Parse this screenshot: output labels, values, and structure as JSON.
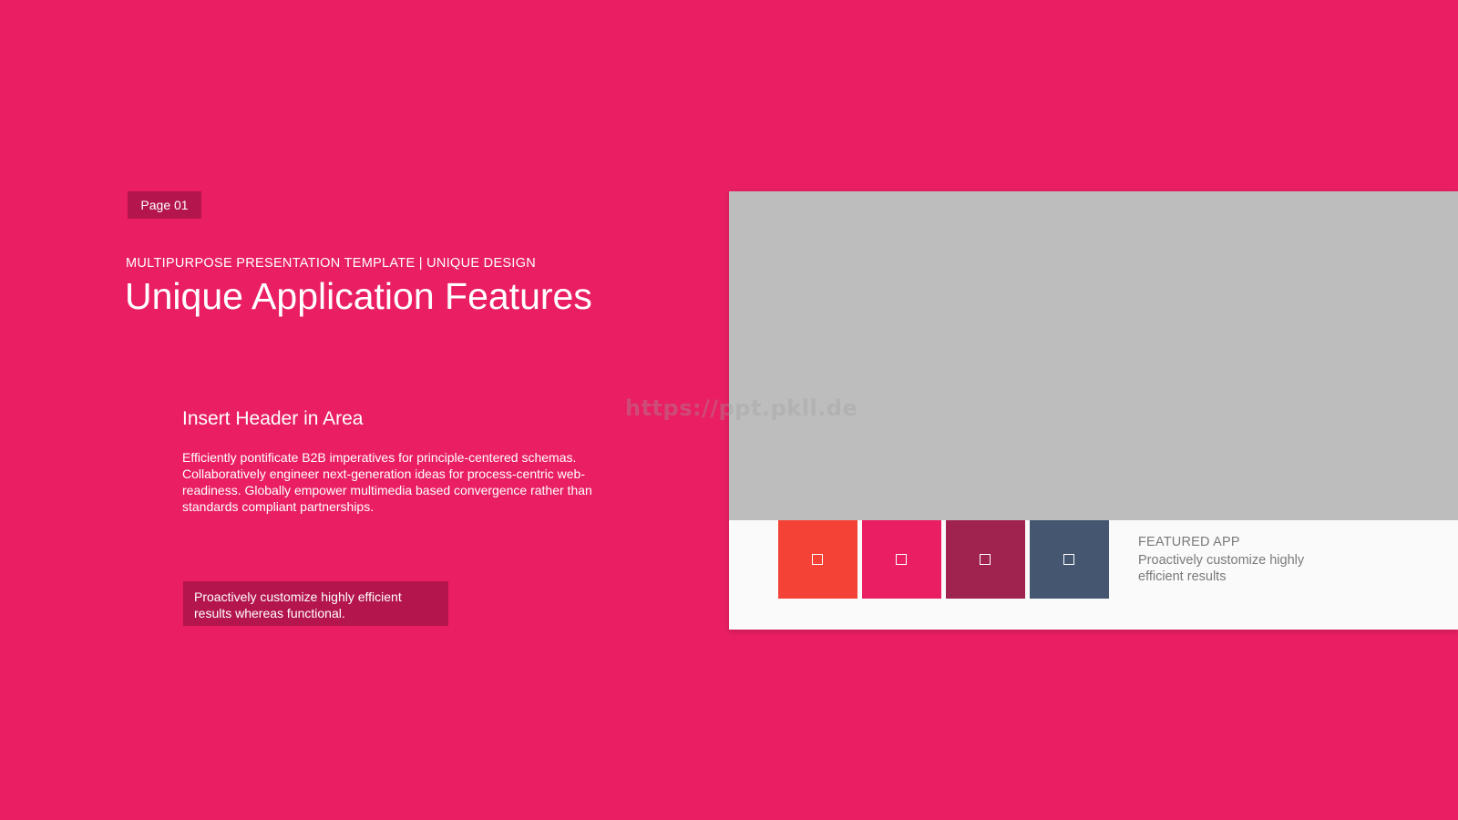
{
  "colors": {
    "background": "#e91e63",
    "badge": "#b3154c",
    "callout": "#b3154c",
    "image_placeholder": "#bdbdbd",
    "card": "#fafafa",
    "muted_text": "#7a7a7a",
    "watermark": "#9e9e9e"
  },
  "badge": {
    "label": "Page 01"
  },
  "header": {
    "subtitle": "MULTIPURPOSE PRESENTATION TEMPLATE | UNIQUE DESIGN",
    "title": "Unique Application Features"
  },
  "section": {
    "heading": "Insert Header in Area",
    "body": "Efficiently pontificate B2B imperatives for principle-centered schemas. Collaboratively engineer next-generation ideas for process-centric web-readiness. Globally empower multimedia based convergence rather than standards compliant partnerships."
  },
  "callout": {
    "text": "Proactively customize highly efficient results whereas functional."
  },
  "card": {
    "featured_label": "FEATURED APP",
    "featured_desc": "Proactively customize highly efficient results",
    "swatches": [
      {
        "color": "#f44336",
        "icon": "square-outline-icon"
      },
      {
        "color": "#e91e63",
        "icon": "square-outline-icon"
      },
      {
        "color": "#a0224e",
        "icon": "square-outline-icon"
      },
      {
        "color": "#455670",
        "icon": "square-outline-icon"
      }
    ]
  },
  "watermark": {
    "text": "https://ppt.pkll.de"
  }
}
